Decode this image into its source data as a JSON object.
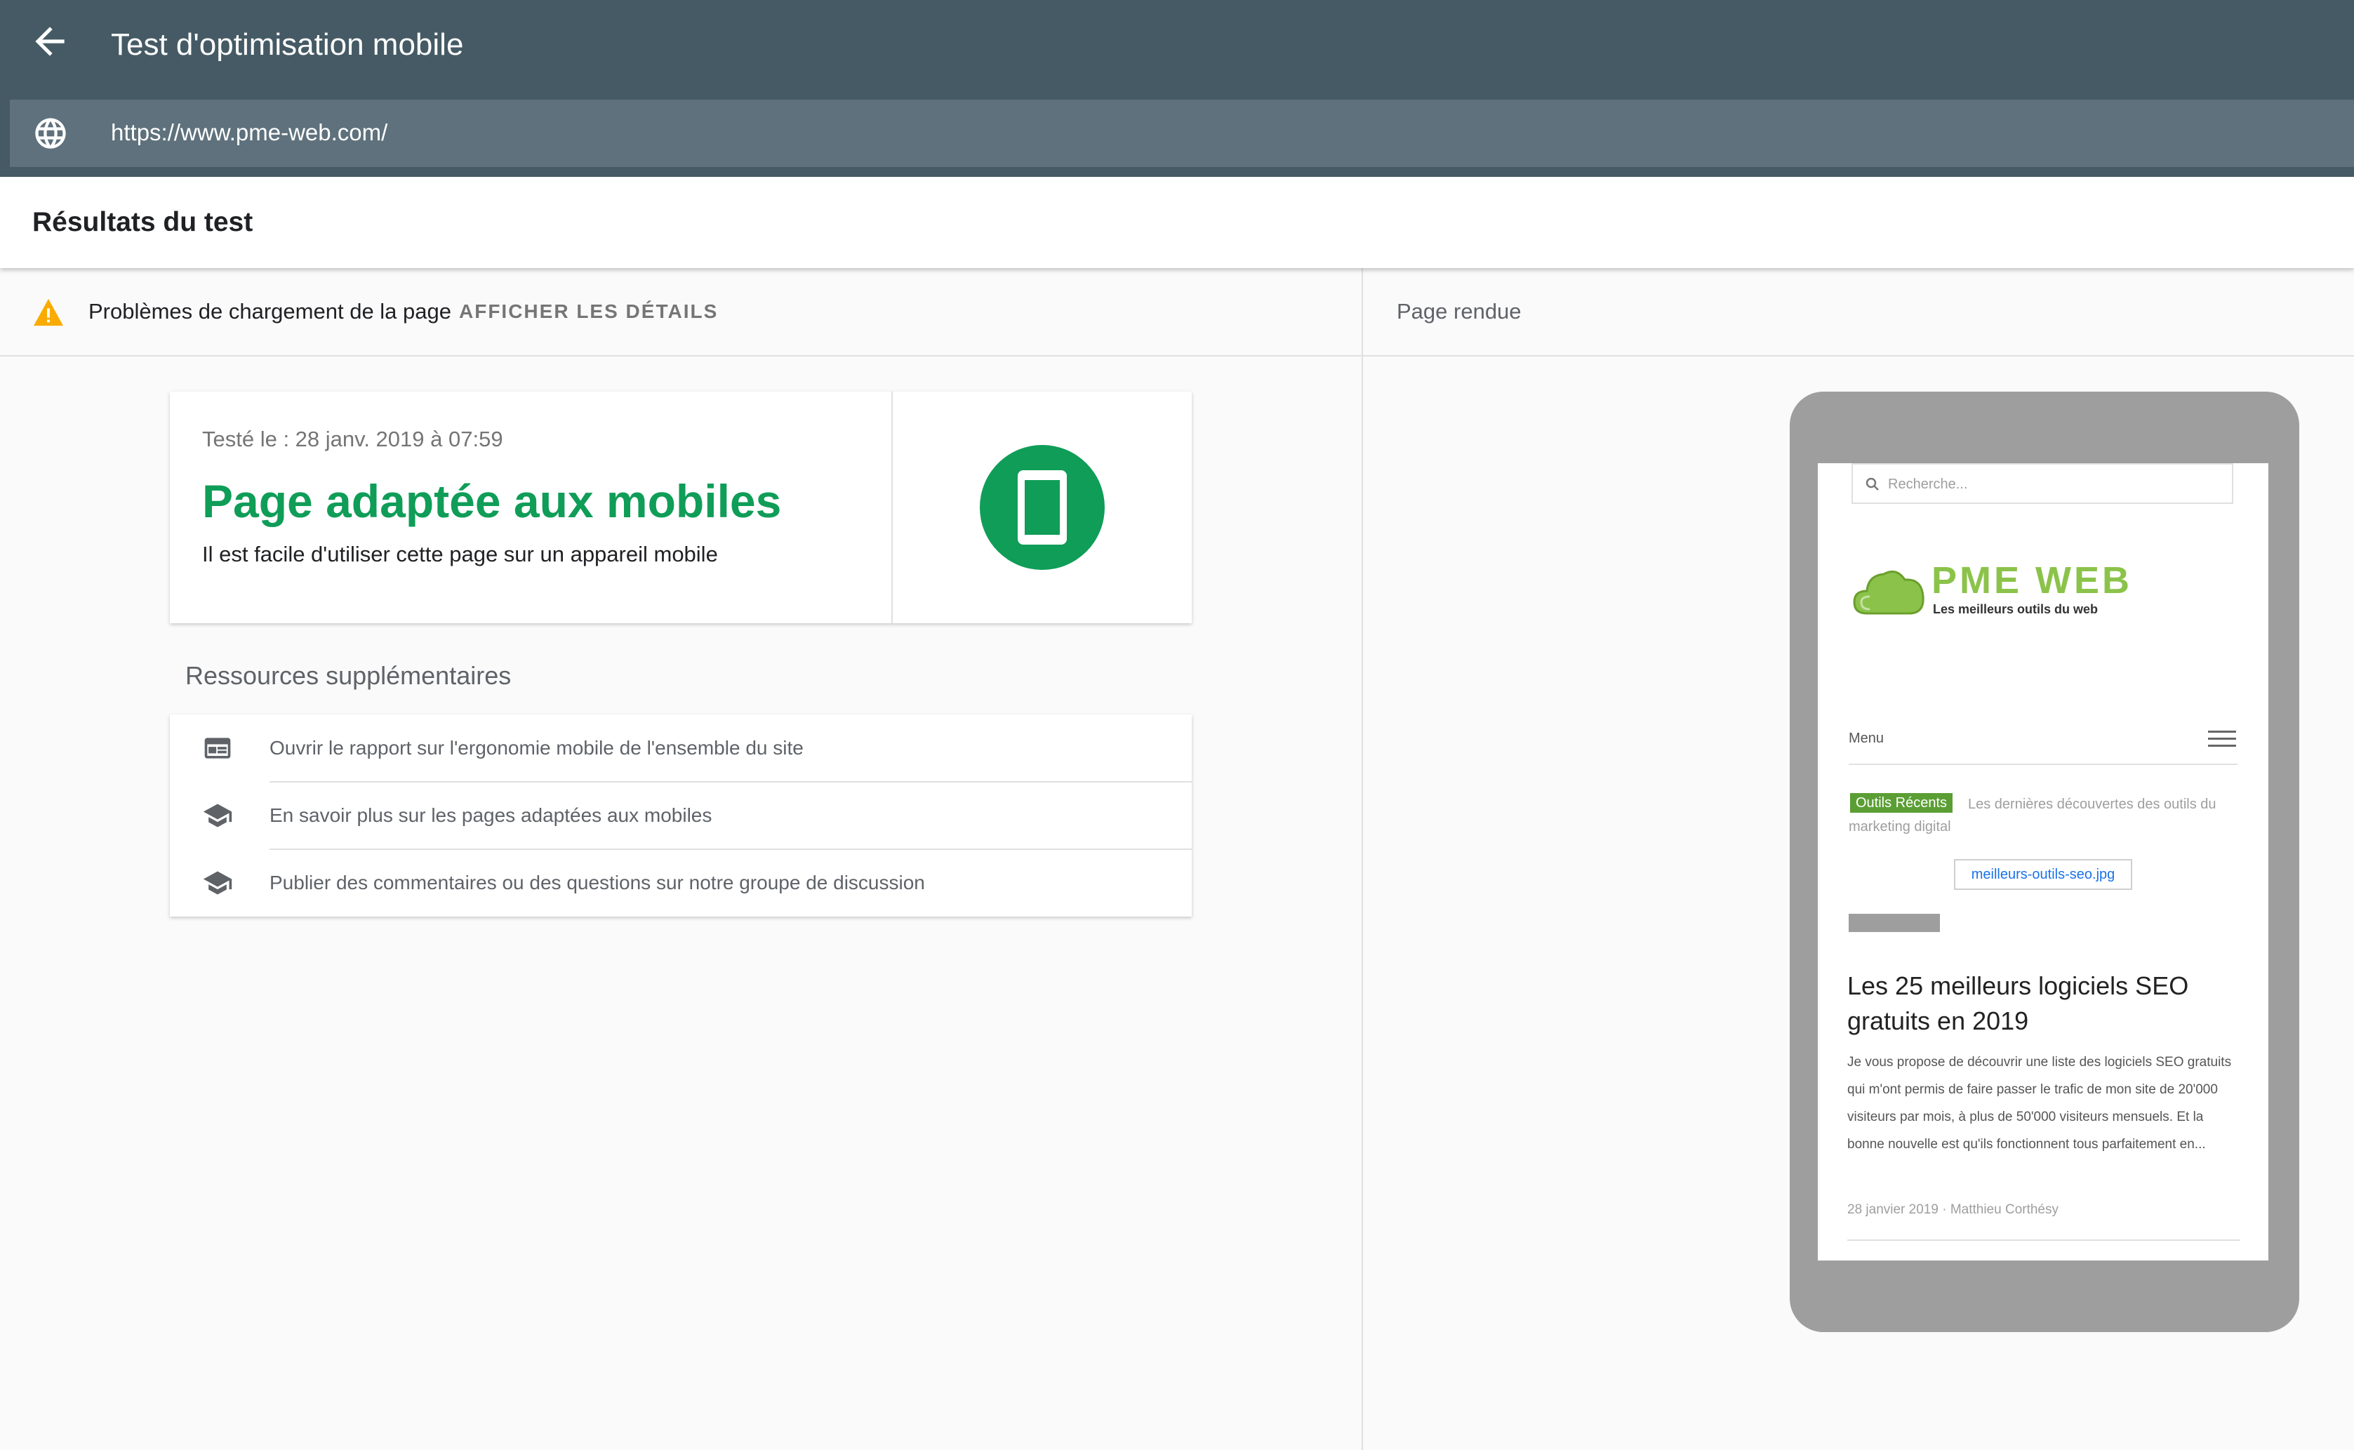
{
  "header": {
    "title": "Test d'optimisation mobile",
    "url": "https://www.pme-web.com/"
  },
  "results": {
    "title": "Résultats du test"
  },
  "notice": {
    "text": "Problèmes de chargement de la page",
    "action": "AFFICHER LES DÉTAILS"
  },
  "result_card": {
    "tested_on": "Testé le : 28 janv. 2019 à 07:59",
    "verdict": "Page adaptée aux mobiles",
    "subtitle": "Il est facile d'utiliser cette page sur un appareil mobile",
    "accent_color": "#0f9d58"
  },
  "resources": {
    "heading": "Ressources supplémentaires",
    "items": [
      {
        "label": "Ouvrir le rapport sur l'ergonomie mobile de l'ensemble du site",
        "icon": "report-icon"
      },
      {
        "label": "En savoir plus sur les pages adaptées aux mobiles",
        "icon": "graduation-cap-icon"
      },
      {
        "label": "Publier des commentaires ou des questions sur notre groupe de discussion",
        "icon": "graduation-cap-icon"
      }
    ]
  },
  "rendered": {
    "label": "Page rendue",
    "site": {
      "search_placeholder": "Recherche...",
      "brand": "PME WEB",
      "tagline": "Les meilleurs outils du web",
      "menu": "Menu",
      "tag": "Outils Récents",
      "tag_text": "Les dernières découvertes des outils du marketing digital",
      "image_link": "meilleurs-outils-seo.jpg",
      "article_title": "Les 25 meilleurs logiciels SEO gratuits en 2019",
      "article_body": "Je vous propose de découvrir une liste des logiciels SEO gratuits qui m'ont permis de faire passer le trafic de mon site de 20'000 visiteurs par mois, à plus de 50'000 visiteurs mensuels. Et la bonne nouvelle est qu'ils fonctionnent tous parfaitement en...",
      "meta": "28 janvier 2019 · Matthieu Corthésy"
    }
  },
  "colors": {
    "header_bg": "#455a64",
    "urlbar_bg": "#5e717c",
    "warning": "#f9ab00",
    "brand_green": "#8bc34a"
  }
}
